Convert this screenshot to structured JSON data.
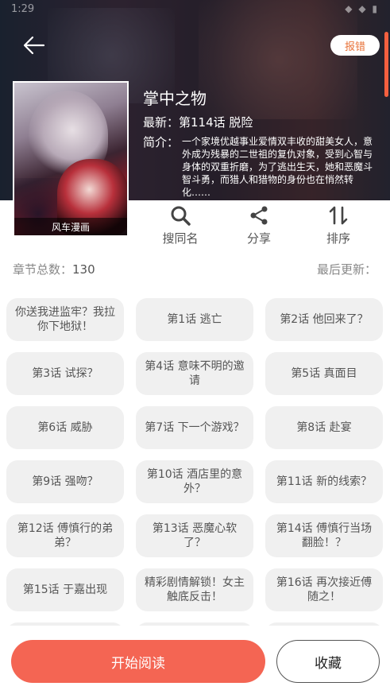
{
  "status_bar": {
    "time": "1:29",
    "icons": "◆ ◆ ▮"
  },
  "header": {
    "back_icon": "arrow-left-icon",
    "report_label": "报错",
    "accent": "#e8733a"
  },
  "comic": {
    "cover_label": "风车漫画",
    "title": "掌中之物",
    "latest_label": "最新：",
    "latest_value": "第114话 脱险",
    "intro_label": "简介：",
    "intro_text": "一个家境优越事业爱情双丰收的甜美女人，意外成为残暴的二世祖的复仇对象，受到心智与身体的双重折磨，为了逃出生天，她和恶魔斗智斗勇，而猎人和猎物的身份也在悄然转化……"
  },
  "actions": [
    {
      "label": "搜同名",
      "icon": "search-icon"
    },
    {
      "label": "分享",
      "icon": "share-icon"
    },
    {
      "label": "排序",
      "icon": "sort-icon"
    }
  ],
  "meta": {
    "total_label": "章节总数：",
    "total_value": "130",
    "updated_label": "最后更新："
  },
  "chapters": [
    "你送我进监牢？我拉你下地狱！",
    "第1话 逃亡",
    "第2话 他回来了？",
    "第3话 试探？",
    "第4话 意味不明的邀请",
    "第5话 真面目",
    "第6话 威胁",
    "第7话 下一个游戏？",
    "第8话 赴宴",
    "第9话 强吻？",
    "第10话 酒店里的意外？",
    "第11话 新的线索？",
    "第12话 傅慎行的弟弟？",
    "第13话 恶魔心软了？",
    "第14话 傅慎行当场翻脸！？",
    "第15话 于嘉出现",
    "精彩剧情解锁！女主触底反击！",
    "第16话 再次接近傅随之！",
    "",
    "",
    ""
  ],
  "bottom": {
    "start_label": "开始阅读",
    "collect_label": "收藏",
    "start_color": "#f46553"
  }
}
